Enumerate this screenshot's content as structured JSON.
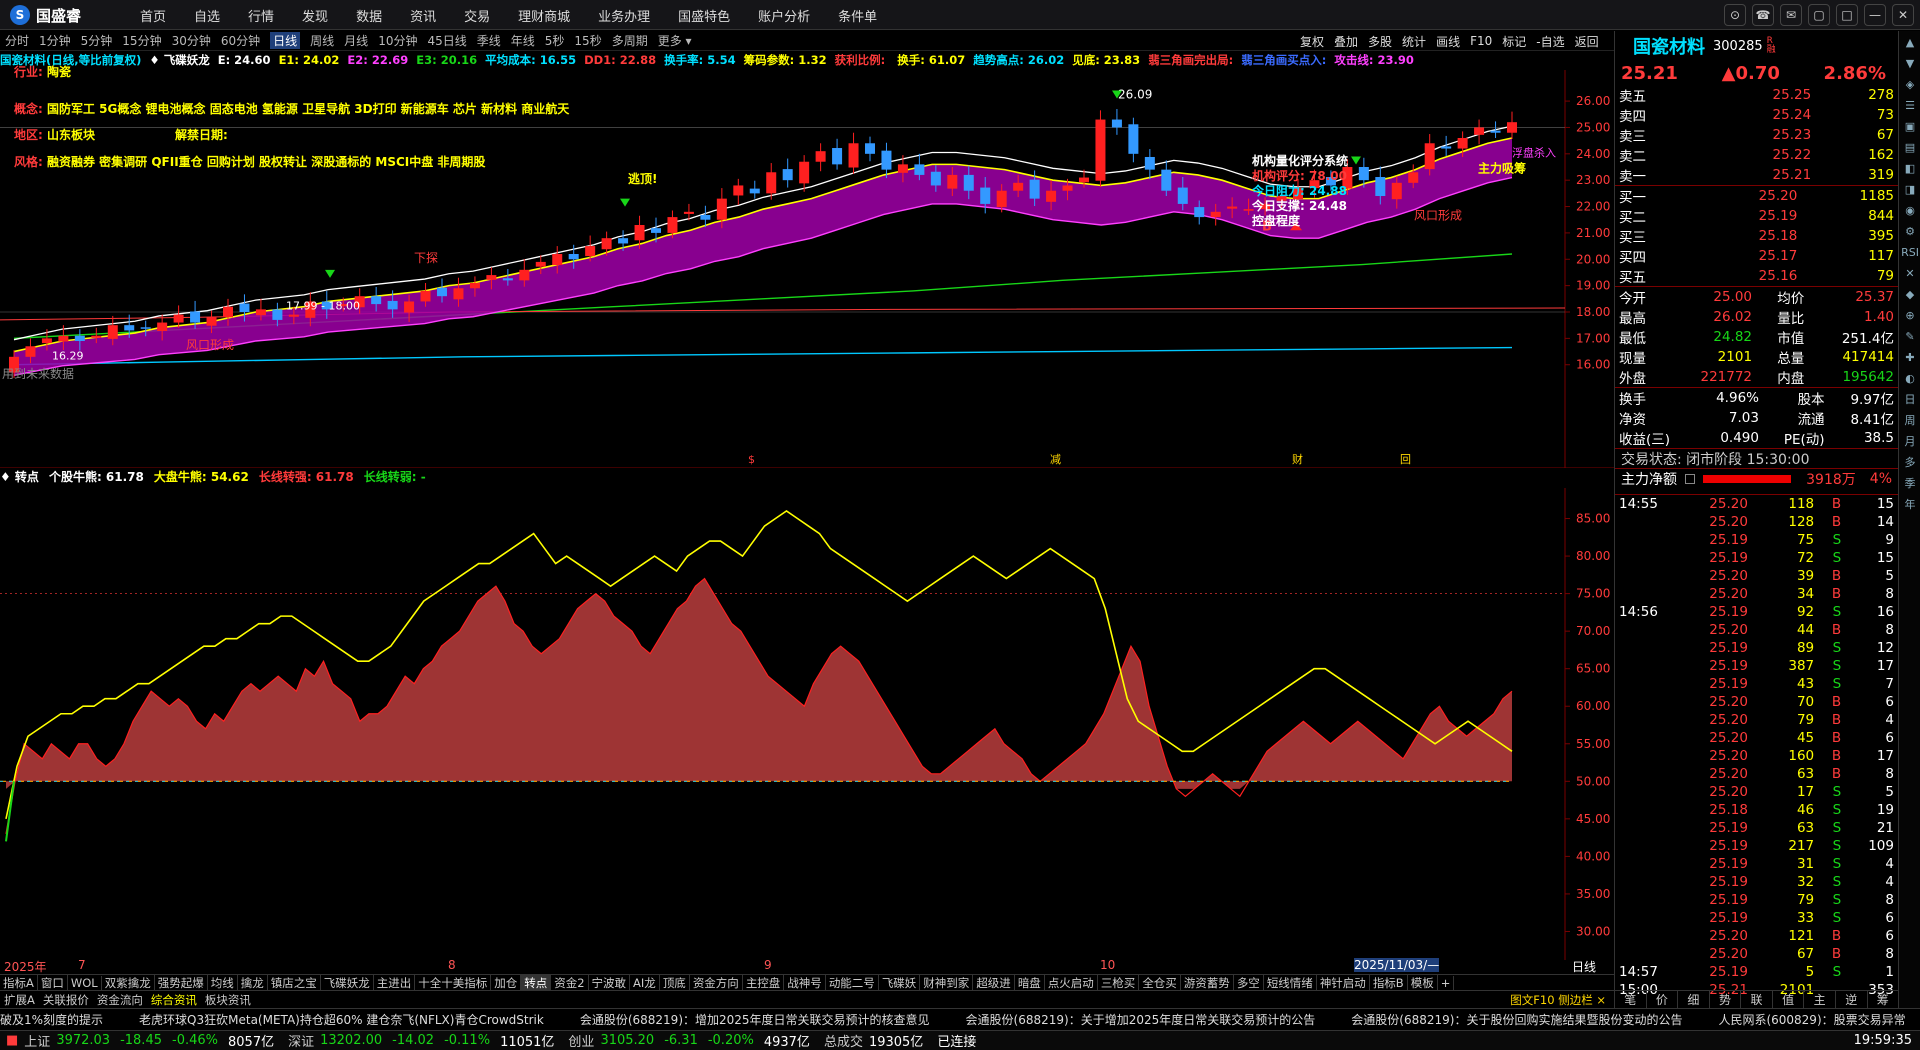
{
  "app": {
    "logo": "国盛睿",
    "nav": [
      "首页",
      "自选",
      "行情",
      "发现",
      "数据",
      "资讯",
      "交易",
      "理财商城",
      "业务办理",
      "国盛特色",
      "账户分析",
      "条件单"
    ]
  },
  "window_buttons": [
    "⊙",
    "☎",
    "✉",
    "▢",
    "□",
    "—",
    "✕"
  ],
  "periods": [
    {
      "label": "分时"
    },
    {
      "label": "1分钟"
    },
    {
      "label": "5分钟"
    },
    {
      "label": "15分钟"
    },
    {
      "label": "30分钟"
    },
    {
      "label": "60分钟"
    },
    {
      "label": "日线",
      "active": true
    },
    {
      "label": "周线"
    },
    {
      "label": "月线"
    },
    {
      "label": "10分钟"
    },
    {
      "label": "45日线"
    },
    {
      "label": "季线"
    },
    {
      "label": "年线"
    },
    {
      "label": "5秒"
    },
    {
      "label": "15秒"
    },
    {
      "label": "多周期"
    },
    {
      "label": "更多 ▾"
    }
  ],
  "chart_buttons": [
    "复权",
    "叠加",
    "多股",
    "统计",
    "画线",
    "F10",
    "标记",
    "-自选",
    "返回"
  ],
  "indicator_line": [
    {
      "text": "国瓷材料(日线,等比前复权)",
      "color": "#00e0ff"
    },
    {
      "text": "♦ 飞碟妖龙",
      "color": "#ffffff"
    },
    {
      "text": "E: 24.60",
      "color": "#ffffff"
    },
    {
      "text": "E1: 24.02",
      "color": "#ffff00"
    },
    {
      "text": "E2: 22.69",
      "color": "#ff40ff"
    },
    {
      "text": "E3: 20.16",
      "color": "#18d618"
    },
    {
      "text": "平均成本: 16.55",
      "color": "#00e0ff"
    },
    {
      "text": "DD1: 22.88",
      "color": "#ff3b3b"
    },
    {
      "text": "换手率: 5.54",
      "color": "#00e0ff"
    },
    {
      "text": "筹码参数: 1.32",
      "color": "#ffff00"
    },
    {
      "text": "获利比例: ",
      "color": "#ff3b3b"
    },
    {
      "text": "换手: 61.07",
      "color": "#ffff00"
    },
    {
      "text": "趋势高点: 26.02",
      "color": "#00e0ff"
    },
    {
      "text": "见底: 23.83",
      "color": "#ffff00"
    },
    {
      "text": "翡三角画完出局:",
      "color": "#ff3b3b"
    },
    {
      "text": "翡三角画买点入:",
      "color": "#3b6bff"
    },
    {
      "text": "攻击线: 23.90",
      "color": "#ff40ff"
    }
  ],
  "stock_info": {
    "industry_label": "行业:",
    "industry": "陶瓷",
    "concept_label": "概念:",
    "concepts": "国防军工 5G概念 锂电池概念 固态电池 氢能源 卫星导航 3D打印 新能源车 芯片 新材料 商业航天",
    "region_label": "地区:",
    "region": "山东板块",
    "unlock_label": "解禁日期:",
    "unlock": "",
    "style_label": "风格:",
    "styles": "融资融券 密集调研 QFII重仓 回购计划 股权转让 深股通标的 MSCI中盘 非周期股"
  },
  "chart_annotations": {
    "peak_label": "26.09",
    "escape_top": "逃顶!",
    "buy_mark": "B",
    "range_label": "17.99 - 18.00",
    "low_label": "16.29",
    "wind_form": "风口形成",
    "no_future": "用到未来数据",
    "xiatan": "下探",
    "zhuli": "主力吸筹",
    "float": "浮盘杀入",
    "score_title": "机构量化评分系统",
    "score": "机构评分: 78.00",
    "resist": "今日阻力: 24.88",
    "support": "今日支撑: 24.48",
    "control": "控盘程度",
    "markers": [
      "$",
      "减",
      "财",
      "回"
    ]
  },
  "price_axis": [
    "26.00",
    "25.00",
    "24.00",
    "23.00",
    "22.00",
    "21.00",
    "20.00",
    "19.00",
    "18.00",
    "17.00",
    "16.00"
  ],
  "sub_axis": [
    "85.00",
    "80.00",
    "75.00",
    "70.00",
    "65.00",
    "60.00",
    "55.00",
    "50.00",
    "45.00",
    "40.00",
    "35.00",
    "30.00"
  ],
  "sub_header": [
    {
      "text": "♦ 转点",
      "color": "#ffffff"
    },
    {
      "text": "个股牛熊: 61.78",
      "color": "#ffffff"
    },
    {
      "text": "大盘牛熊: 54.62",
      "color": "#ffff00"
    },
    {
      "text": "长线转强: 61.78",
      "color": "#ff3b3b"
    },
    {
      "text": "长线转弱: -",
      "color": "#18d618"
    }
  ],
  "x_axis": [
    {
      "label": "2025年",
      "x": 4
    },
    {
      "label": "7",
      "x": 78
    },
    {
      "label": "8",
      "x": 448
    },
    {
      "label": "9",
      "x": 764
    },
    {
      "label": "10",
      "x": 1100
    },
    {
      "label": "2025/11/03/—",
      "x": 1354,
      "highlight": true
    }
  ],
  "x_axis_end": "日线",
  "tabs": [
    "指标A",
    "窗口",
    "WOL",
    "双紫擒龙",
    "强势起爆",
    "均线",
    "擒龙",
    "镇店之宝",
    "飞碟妖龙",
    "主进出",
    "十全十美指标",
    "加仓",
    "转点",
    "资金2",
    "宁波敢",
    "AI龙",
    "顶底",
    "资金方向",
    "主控盘",
    "战神号",
    "动能二号",
    "飞碟妖",
    "财神到家",
    "超级进",
    "暗盘",
    "点火启动",
    "三枪买",
    "全仓买",
    "游资蓄势",
    "多空",
    "短线情绪",
    "神针启动",
    "指标B",
    "模板",
    "+"
  ],
  "active_tab": "转点",
  "tabs2": [
    "扩展A",
    "关联报价",
    "资金流向",
    "综合资讯",
    "板块资讯"
  ],
  "active_tab2": "综合资讯",
  "tabs2_right": "图文F10 侧边栏 ×",
  "news": [
    "破及1%刻度的提示",
    "老虎环球Q3狂砍Meta(META)持仓超60% 建仓奈飞(NFLX)青仓CrowdStrik",
    "会通股份(688219)：增加2025年度日常关联交易预计的核查意见",
    "会通股份(688219)：关于增加2025年度日常关联交易预计的公告",
    "会通股份(688219)：关于股份回购实施结果暨股份变动的公告",
    "人民网系(600829)：股票交易异常"
  ],
  "status": {
    "sh_label": "上证",
    "sh": "3972.03",
    "sh_chg": "-18.45",
    "sh_pct": "-0.46%",
    "sh_amt": "8057亿",
    "sz_label": "深证",
    "sz": "13202.00",
    "sz_chg": "-14.02",
    "sz_pct": "-0.11%",
    "sz_amt": "11051亿",
    "cy_label": "创业",
    "cy": "3105.20",
    "cy_chg": "-6.31",
    "cy_pct": "-0.20%",
    "cy_amt": "4937亿",
    "total_label": "总成交",
    "total": "19305亿",
    "conn": "已连接",
    "time": "19:59:35"
  },
  "quote": {
    "name": "国瓷材料",
    "code": "300285",
    "badge": "R\n融",
    "price": "25.21",
    "change": "▲0.70",
    "pct": "2.86%",
    "asks": [
      [
        "卖五",
        "25.25",
        "278"
      ],
      [
        "卖四",
        "25.24",
        "73"
      ],
      [
        "卖三",
        "25.23",
        "67"
      ],
      [
        "卖二",
        "25.22",
        "162"
      ],
      [
        "卖一",
        "25.21",
        "319"
      ]
    ],
    "bids": [
      [
        "买一",
        "25.20",
        "1185"
      ],
      [
        "买二",
        "25.19",
        "844"
      ],
      [
        "买三",
        "25.18",
        "395"
      ],
      [
        "买四",
        "25.17",
        "117"
      ],
      [
        "买五",
        "25.16",
        "79"
      ]
    ],
    "stats": [
      [
        "今开",
        "25.00",
        "均价",
        "25.37"
      ],
      [
        "最高",
        "26.02",
        "量比",
        "1.40"
      ],
      [
        "最低",
        "24.82",
        "市值",
        "251.4亿"
      ],
      [
        "现量",
        "2101",
        "总量",
        "417414"
      ],
      [
        "外盘",
        "221772",
        "内盘",
        "195642"
      ]
    ],
    "stats2": [
      [
        "换手",
        "4.96%",
        "股本",
        "9.97亿"
      ],
      [
        "净资",
        "7.03",
        "流通",
        "8.41亿"
      ],
      [
        "收益(三)",
        "0.490",
        "PE(动)",
        "38.5"
      ]
    ],
    "trade_status": "交易状态: 闭市阶段 15:30:00",
    "main_net_label": "主力净额",
    "main_net": "3918万",
    "main_net_pct": "4%",
    "ticks": [
      [
        "14:55",
        "25.20",
        "118",
        "B",
        "15"
      ],
      [
        "",
        "25.20",
        "128",
        "B",
        "14"
      ],
      [
        "",
        "25.19",
        "75",
        "S",
        "9"
      ],
      [
        "",
        "25.19",
        "72",
        "S",
        "15"
      ],
      [
        "",
        "25.20",
        "39",
        "B",
        "5"
      ],
      [
        "",
        "25.20",
        "34",
        "B",
        "8"
      ],
      [
        "14:56",
        "25.19",
        "92",
        "S",
        "16"
      ],
      [
        "",
        "25.20",
        "44",
        "B",
        "8"
      ],
      [
        "",
        "25.19",
        "89",
        "S",
        "12"
      ],
      [
        "",
        "25.19",
        "387",
        "S",
        "17"
      ],
      [
        "",
        "25.19",
        "43",
        "S",
        "7"
      ],
      [
        "",
        "25.20",
        "70",
        "B",
        "6"
      ],
      [
        "",
        "25.20",
        "79",
        "B",
        "4"
      ],
      [
        "",
        "25.20",
        "45",
        "B",
        "6"
      ],
      [
        "",
        "25.20",
        "160",
        "B",
        "17"
      ],
      [
        "",
        "25.20",
        "63",
        "B",
        "8"
      ],
      [
        "",
        "25.20",
        "17",
        "S",
        "5"
      ],
      [
        "",
        "25.18",
        "46",
        "S",
        "19"
      ],
      [
        "",
        "25.19",
        "63",
        "S",
        "21"
      ],
      [
        "",
        "25.19",
        "217",
        "S",
        "109"
      ],
      [
        "",
        "25.19",
        "31",
        "S",
        "4"
      ],
      [
        "",
        "25.19",
        "32",
        "S",
        "4"
      ],
      [
        "",
        "25.19",
        "79",
        "S",
        "8"
      ],
      [
        "",
        "25.19",
        "33",
        "S",
        "6"
      ],
      [
        "",
        "25.20",
        "121",
        "B",
        "6"
      ],
      [
        "",
        "25.20",
        "67",
        "B",
        "8"
      ],
      [
        "14:57",
        "25.19",
        "5",
        "S",
        "1"
      ],
      [
        "15:00",
        "25.21",
        "2101",
        "",
        "353"
      ]
    ],
    "bottom_tabs": [
      "笔",
      "价",
      "细",
      "势",
      "联",
      "值",
      "主",
      "逆",
      "筹"
    ]
  },
  "side_icons": [
    "▲",
    "▼",
    "◈",
    "☰",
    "▣",
    "▤",
    "◧",
    "◨",
    "◉",
    "⚙",
    "RSI",
    "✕",
    "◆",
    "⊕",
    "✎",
    "✚",
    "◐",
    "日",
    "周",
    "月",
    "多",
    "季",
    "年"
  ],
  "chart_data": [
    {
      "type": "candlestick",
      "title": "国瓷材料(日线,等比前复权)",
      "ylim": [
        15.8,
        26.8
      ],
      "close": [
        16.3,
        16.7,
        17.0,
        17.1,
        16.9,
        17.1,
        17.5,
        17.3,
        17.4,
        17.6,
        17.9,
        17.6,
        17.8,
        18.2,
        18.0,
        18.1,
        17.7,
        17.9,
        18.4,
        18.1,
        18.3,
        18.6,
        18.3,
        18.1,
        18.4,
        18.8,
        18.6,
        18.9,
        19.1,
        19.4,
        19.2,
        19.6,
        19.9,
        20.2,
        20.0,
        20.5,
        20.8,
        20.6,
        21.3,
        21.0,
        21.6,
        21.8,
        21.5,
        22.3,
        22.8,
        22.5,
        23.3,
        23.0,
        23.7,
        24.1,
        23.6,
        24.4,
        24.0,
        23.4,
        23.6,
        23.2,
        22.8,
        23.2,
        22.6,
        22.1,
        22.6,
        22.9,
        22.3,
        22.6,
        22.8,
        23.1,
        25.3,
        25.0,
        24.0,
        23.4,
        22.6,
        22.1,
        21.6,
        21.8,
        22.0,
        21.9,
        22.1,
        22.4,
        22.7,
        23.0,
        22.8,
        23.5,
        23.0,
        22.4,
        22.9,
        23.3,
        24.4,
        24.2,
        24.6,
        25.0,
        24.8,
        25.2
      ],
      "ma_e": [
        16.5,
        16.7,
        16.9,
        17.0,
        17.1,
        17.2,
        17.4,
        17.5,
        17.6,
        17.8,
        18.0,
        18.1,
        18.2,
        18.4,
        18.5,
        18.6,
        18.7,
        18.8,
        19.0,
        19.1,
        19.3,
        19.5,
        19.7,
        19.9,
        20.1,
        20.4,
        20.6,
        20.9,
        21.1,
        21.4,
        21.6,
        21.9,
        22.1,
        22.3,
        22.6,
        22.9,
        23.2,
        23.4,
        23.6,
        23.6,
        23.5,
        23.4,
        23.2,
        23.0,
        22.9,
        22.8,
        22.9,
        23.1,
        23.3,
        23.2,
        23.0,
        22.7,
        22.4,
        22.3,
        22.3,
        22.6,
        22.9,
        23.1,
        23.4,
        23.8,
        24.1,
        24.4,
        24.6
      ],
      "lines": [
        {
          "name": "E3",
          "values": [
            17.0,
            17.3,
            17.6,
            17.9,
            18.2,
            18.5,
            18.8,
            19.2,
            19.5,
            19.8,
            20.2
          ]
        },
        {
          "name": "平均成本",
          "values": [
            16.0,
            16.1,
            16.2,
            16.3,
            16.35,
            16.4,
            16.45,
            16.5,
            16.55,
            16.6,
            16.65
          ]
        }
      ]
    },
    {
      "type": "area",
      "title": "转点",
      "ylim": [
        27,
        88
      ],
      "series": [
        {
          "name": "个股牛熊",
          "values": [
            43,
            50,
            55,
            54,
            53,
            55,
            54,
            53,
            55,
            55,
            53,
            52,
            53,
            55,
            58,
            60,
            62,
            61,
            60,
            61,
            60,
            58,
            57,
            59,
            58,
            60,
            62,
            63,
            62,
            63,
            64,
            63,
            62,
            65,
            64,
            66,
            63,
            62,
            61,
            58,
            59,
            59,
            60,
            62,
            64,
            63,
            65,
            66,
            68,
            69,
            70,
            72,
            74,
            75,
            76,
            74,
            71,
            70,
            68,
            67,
            68,
            69,
            71,
            73,
            74,
            75,
            74,
            72,
            71,
            70,
            68,
            67,
            69,
            71,
            73,
            74,
            76,
            77,
            75,
            73,
            71,
            70,
            68,
            66,
            64,
            63,
            62,
            61,
            60,
            63,
            65,
            67,
            68,
            67,
            66,
            64,
            62,
            60,
            58,
            56,
            54,
            52,
            51,
            51,
            52,
            53,
            54,
            55,
            56,
            57,
            55,
            54,
            53,
            51,
            50,
            51,
            52,
            53,
            54,
            55,
            57,
            59,
            62,
            65,
            68,
            66,
            60,
            56,
            52,
            49,
            48,
            49,
            50,
            51,
            50,
            49,
            48,
            50,
            52,
            54,
            55,
            56,
            57,
            58,
            57,
            56,
            55,
            56,
            57,
            58,
            57,
            56,
            55,
            54,
            53,
            55,
            57,
            59,
            60,
            58,
            57,
            56,
            57,
            58,
            59,
            61,
            62
          ]
        },
        {
          "name": "大盘牛熊",
          "values": [
            45,
            52,
            56,
            57,
            58,
            59,
            59,
            60,
            60,
            61,
            61,
            62,
            63,
            63,
            64,
            65,
            66,
            67,
            68,
            68,
            69,
            69,
            70,
            71,
            71,
            72,
            72,
            71,
            70,
            69,
            68,
            67,
            66,
            66,
            67,
            68,
            70,
            72,
            74,
            75,
            76,
            77,
            78,
            79,
            79,
            80,
            81,
            82,
            83,
            81,
            79,
            80,
            79,
            78,
            77,
            76,
            77,
            78,
            79,
            80,
            79,
            78,
            80,
            81,
            82,
            82,
            81,
            80,
            82,
            84,
            85,
            86,
            85,
            84,
            83,
            81,
            80,
            79,
            78,
            77,
            76,
            75,
            74,
            75,
            76,
            77,
            78,
            79,
            80,
            79,
            78,
            77,
            78,
            79,
            80,
            81,
            80,
            79,
            78,
            77,
            73,
            67,
            61,
            58,
            57,
            56,
            55,
            54,
            54,
            55,
            56,
            57,
            58,
            59,
            60,
            61,
            62,
            63,
            64,
            65,
            65,
            64,
            63,
            62,
            61,
            60,
            59,
            58,
            57,
            56,
            55,
            56,
            57,
            58,
            57,
            56,
            55,
            54
          ]
        }
      ]
    }
  ]
}
